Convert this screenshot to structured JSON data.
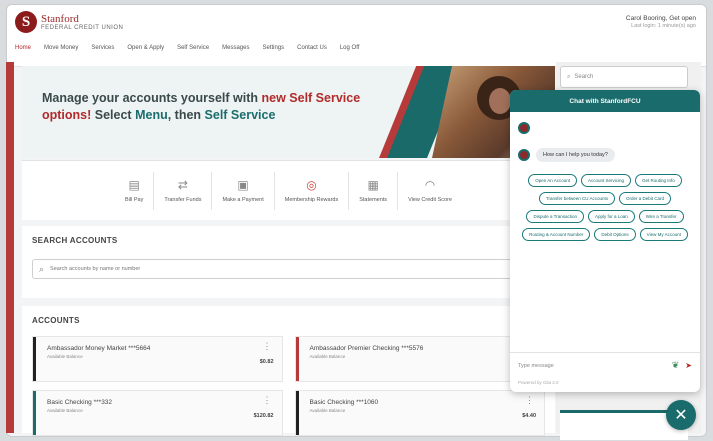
{
  "brand": {
    "name": "Stanford",
    "sub": "FEDERAL CREDIT UNION"
  },
  "user": {
    "name": "Carol Booring, Get open",
    "sub": "Last login: 1 minute(s) ago"
  },
  "nav": [
    "Home",
    "Move Money",
    "Services",
    "Open & Apply",
    "Self Service",
    "Messages",
    "Settings",
    "Contact Us",
    "Log Off"
  ],
  "banner": {
    "line1_pre": "Manage your accounts yourself with ",
    "line1_red": "new Self Service",
    "line2_red": "options!",
    "line2_mid": " Select ",
    "line2_menu": "Menu",
    "line2_then": ", then ",
    "line2_ss": "Self Service"
  },
  "quick_actions": [
    {
      "icon": "bill-pay-icon",
      "glyph": "▤",
      "label": "Bill Pay"
    },
    {
      "icon": "transfer-icon",
      "glyph": "⇄",
      "label": "Transfer Funds"
    },
    {
      "icon": "payment-icon",
      "glyph": "▣",
      "label": "Make a Payment"
    },
    {
      "icon": "rewards-icon",
      "glyph": "◎",
      "label": "Membership Rewards"
    },
    {
      "icon": "statements-icon",
      "glyph": "▦",
      "label": "Statements"
    },
    {
      "icon": "credit-score-icon",
      "glyph": "◠",
      "label": "View Credit Score"
    }
  ],
  "search": {
    "title": "SEARCH ACCOUNTS",
    "placeholder": "Search accounts by name or number"
  },
  "accounts": {
    "title": "ACCOUNTS",
    "items": [
      {
        "name": "Ambassador Money Market ***5664",
        "sub": "Available Balance",
        "balance": "$0.82",
        "color": "#222222"
      },
      {
        "name": "Ambassador Premier Checking ***5576",
        "sub": "Available Balance",
        "balance": "",
        "color": "#b63a3a"
      },
      {
        "name": "Basic Checking ***332",
        "sub": "Available Balance",
        "balance": "$120.82",
        "color": "#1a6b6b"
      },
      {
        "name": "Basic Checking ***1060",
        "sub": "Available Balance",
        "balance": "$4.40",
        "color": "#222222"
      }
    ]
  },
  "right": {
    "search_placeholder": "Search"
  },
  "chat": {
    "title": "Chat with StanfordFCU",
    "greeting": "How can I help you today?",
    "chips": [
      "Open An Account",
      "Account Servicing",
      "Get Routing Info",
      "Transfer between CU Accounts",
      "Order a Debit Card",
      "Dispute a Transaction",
      "Apply for a Loan",
      "Wire a Transfer",
      "Routing & Account Number",
      "Debit Options",
      "View My Account"
    ],
    "input_placeholder": "Type message",
    "footer": "Powered by Glia 2.0"
  },
  "colors": {
    "brand_red": "#b22a2a",
    "teal": "#1a6b6b"
  }
}
